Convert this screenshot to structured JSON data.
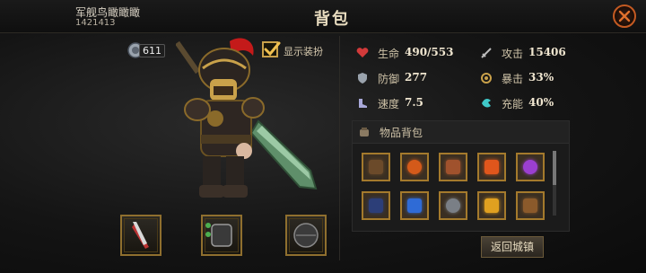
{
  "header": {
    "player_name": "军舰鸟瞰瞰瞰",
    "player_id": "1421413",
    "title": "背包"
  },
  "currency": {
    "value": "611"
  },
  "costume": {
    "label": "显示装扮",
    "checked": true
  },
  "stats": [
    {
      "icon": "heart-icon",
      "label": "生命",
      "value": "490/553"
    },
    {
      "icon": "sword-icon",
      "label": "攻击",
      "value": "15406"
    },
    {
      "icon": "shield-icon",
      "label": "防御",
      "value": "277"
    },
    {
      "icon": "target-icon",
      "label": "暴击",
      "value": "33%"
    },
    {
      "icon": "boot-icon",
      "label": "速度",
      "value": "7.5"
    },
    {
      "icon": "energy-icon",
      "label": "充能",
      "value": "40%"
    }
  ],
  "bag": {
    "title": "物品背包",
    "items": [
      {
        "icon": "armor-piece-icon",
        "color": "#6b4a2a"
      },
      {
        "icon": "fire-orb-icon",
        "color": "#d45a1a"
      },
      {
        "icon": "meat-icon",
        "color": "#a0522d"
      },
      {
        "icon": "flame-shard-icon",
        "color": "#e0561c"
      },
      {
        "icon": "purple-gem-icon",
        "color": "#9b3fd0"
      },
      {
        "icon": "blue-armor-icon",
        "color": "#2c3e78"
      },
      {
        "icon": "blue-gem-icon",
        "color": "#2f6bd6"
      },
      {
        "icon": "stone-icon",
        "color": "#7a7f86"
      },
      {
        "icon": "gold-coin-icon",
        "color": "#e0a020"
      },
      {
        "icon": "pouch-icon",
        "color": "#8b5a2b"
      }
    ]
  },
  "return_button": {
    "label": "返回城镇"
  },
  "colors": {
    "accent": "#c45a22",
    "gold_border": "#a47a2c"
  }
}
